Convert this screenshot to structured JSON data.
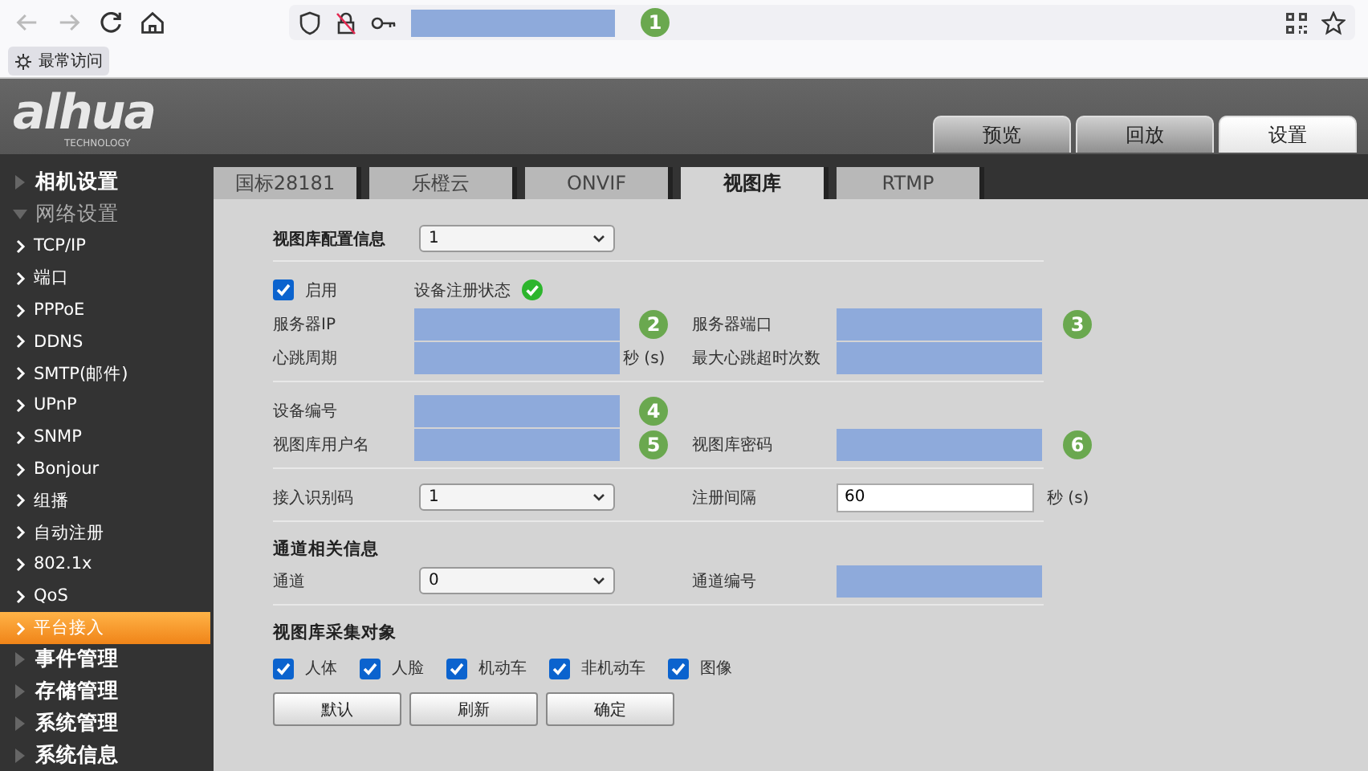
{
  "browser": {
    "address_badge": "1",
    "bookmarks": [
      {
        "label": "最常访问"
      }
    ]
  },
  "header": {
    "logo": "alhua",
    "logo_tagline": "TECHNOLOGY",
    "tabs": [
      {
        "label": "预览",
        "selected": false
      },
      {
        "label": "回放",
        "selected": false
      },
      {
        "label": "设置",
        "selected": true
      }
    ]
  },
  "sidebar": {
    "items": [
      {
        "label": "相机设置",
        "expanded": false
      },
      {
        "label": "网络设置",
        "expanded": true,
        "children": [
          {
            "label": "TCP/IP",
            "selected": false
          },
          {
            "label": "端口",
            "selected": false
          },
          {
            "label": "PPPoE",
            "selected": false
          },
          {
            "label": "DDNS",
            "selected": false
          },
          {
            "label": "SMTP(邮件)",
            "selected": false
          },
          {
            "label": "UPnP",
            "selected": false
          },
          {
            "label": "SNMP",
            "selected": false
          },
          {
            "label": "Bonjour",
            "selected": false
          },
          {
            "label": "组播",
            "selected": false
          },
          {
            "label": "自动注册",
            "selected": false
          },
          {
            "label": "802.1x",
            "selected": false
          },
          {
            "label": "QoS",
            "selected": false
          },
          {
            "label": "平台接入",
            "selected": true
          }
        ]
      },
      {
        "label": "事件管理",
        "expanded": false
      },
      {
        "label": "存储管理",
        "expanded": false
      },
      {
        "label": "系统管理",
        "expanded": false
      },
      {
        "label": "系统信息",
        "expanded": false
      }
    ]
  },
  "tabs": [
    {
      "label": "国标28181",
      "selected": false
    },
    {
      "label": "乐橙云",
      "selected": false
    },
    {
      "label": "ONVIF",
      "selected": false
    },
    {
      "label": "视图库",
      "selected": true
    },
    {
      "label": "RTMP",
      "selected": false
    }
  ],
  "form": {
    "sections": [
      {
        "rows": [
          {
            "kind": "fields",
            "left": {
              "label": "视图库配置信息",
              "heading": true,
              "kind": "select",
              "value": "1"
            }
          }
        ]
      },
      {
        "rows": [
          {
            "kind": "fields",
            "left": {
              "label": "启用",
              "kind": "checkbox",
              "checked": true,
              "status": {
                "label": "设备注册状态",
                "registered": true
              }
            }
          },
          {
            "kind": "fields",
            "left": {
              "label": "服务器IP",
              "kind": "redacted",
              "badge": "2"
            },
            "right": {
              "label": "服务器端口",
              "kind": "redacted",
              "badge": "3"
            }
          },
          {
            "kind": "fields",
            "left": {
              "label": "心跳周期",
              "kind": "redacted",
              "unit": "秒 (s)"
            },
            "right": {
              "label": "最大心跳超时次数",
              "kind": "redacted"
            }
          }
        ]
      },
      {
        "rows": [
          {
            "kind": "fields",
            "left": {
              "label": "设备编号",
              "kind": "redacted",
              "badge": "4"
            }
          },
          {
            "kind": "fields",
            "left": {
              "label": "视图库用户名",
              "kind": "redacted",
              "badge": "5"
            },
            "right": {
              "label": "视图库密码",
              "kind": "redacted",
              "badge": "6"
            }
          }
        ]
      },
      {
        "rows": [
          {
            "kind": "fields",
            "left": {
              "label": "接入识别码",
              "kind": "select",
              "value": "1"
            },
            "right": {
              "label": "注册间隔",
              "kind": "text",
              "value": "60",
              "unit": "秒 (s)"
            }
          }
        ]
      },
      {
        "rows": [
          {
            "kind": "heading",
            "text": "通道相关信息"
          },
          {
            "kind": "fields",
            "left": {
              "label": "通道",
              "kind": "select",
              "value": "0"
            },
            "right": {
              "label": "通道编号",
              "kind": "redacted"
            }
          }
        ]
      },
      {
        "rows": [
          {
            "kind": "heading",
            "text": "视图库采集对象"
          },
          {
            "kind": "checks",
            "items": [
              {
                "label": "人体",
                "checked": true
              },
              {
                "label": "人脸",
                "checked": true
              },
              {
                "label": "机动车",
                "checked": true
              },
              {
                "label": "非机动车",
                "checked": true
              },
              {
                "label": "图像",
                "checked": true
              }
            ]
          },
          {
            "kind": "buttons",
            "items": [
              {
                "label": "默认"
              },
              {
                "label": "刷新"
              },
              {
                "label": "确定"
              }
            ]
          }
        ]
      }
    ]
  }
}
